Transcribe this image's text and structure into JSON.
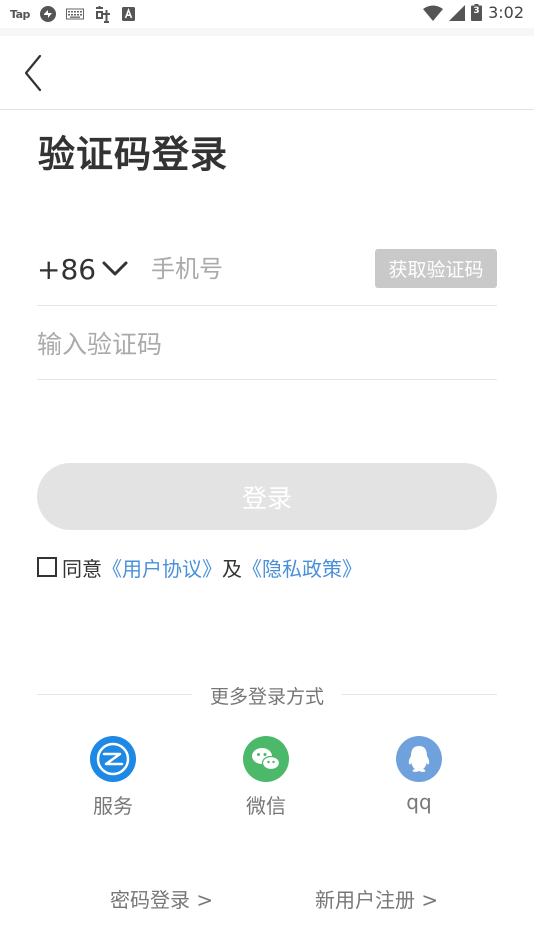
{
  "status_bar": {
    "app_label": "Tap",
    "battery_level": "3",
    "time": "3:02",
    "icons": [
      "taptap-icon",
      "sync-icon",
      "keyboard-icon",
      "translate-icon",
      "a-box-icon",
      "wifi-icon",
      "signal-icon",
      "battery-icon"
    ]
  },
  "page": {
    "title": "验证码登录"
  },
  "form": {
    "country_code": "+86",
    "phone_placeholder": "手机号",
    "get_code_label": "获取验证码",
    "code_placeholder": "输入验证码",
    "login_label": "登录"
  },
  "agreement": {
    "prefix": "同意",
    "user_agreement": "《用户协议》",
    "and": "及",
    "privacy_policy": "《隐私政策》",
    "checked": false
  },
  "more_login": {
    "label": "更多登录方式",
    "options": [
      {
        "name": "服务",
        "icon": "service-icon",
        "color": "#1e88e5"
      },
      {
        "name": "微信",
        "icon": "wechat-icon",
        "color": "#4cb86a"
      },
      {
        "name": "qq",
        "icon": "qq-icon",
        "color": "#6fa2dc"
      }
    ]
  },
  "bottom": {
    "password_login": "密码登录 >",
    "register": "新用户注册 >"
  },
  "colors": {
    "link": "#4a90d9",
    "button_disabled": "#e3e3e3",
    "get_code_bg": "#c9c9c9"
  }
}
